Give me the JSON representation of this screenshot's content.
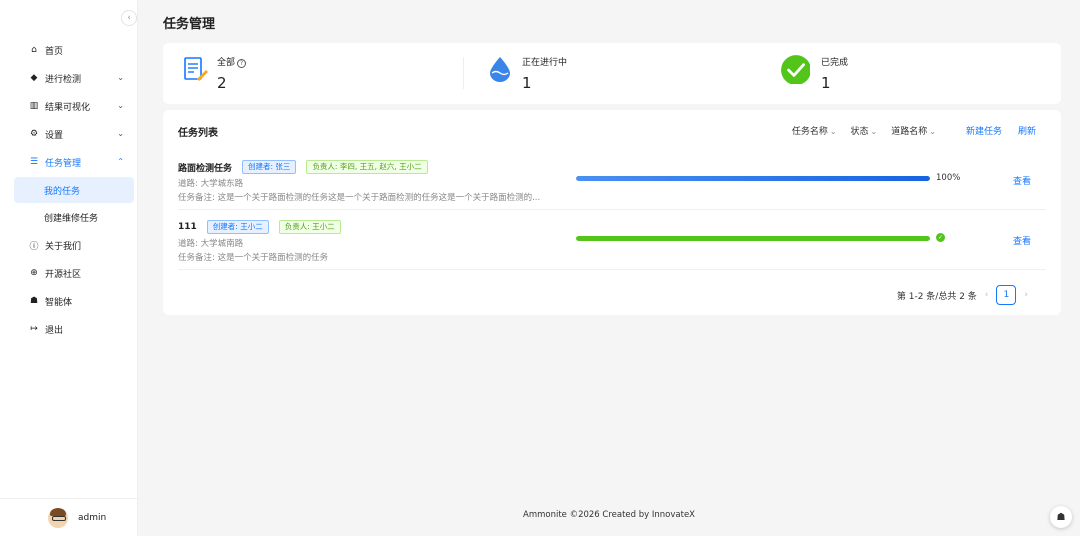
{
  "sidebar": {
    "items": [
      {
        "label": "首页",
        "icon": "home-icon"
      },
      {
        "label": "进行检测",
        "icon": "box-icon"
      },
      {
        "label": "结果可视化",
        "icon": "chart-icon"
      },
      {
        "label": "设置",
        "icon": "gears-icon"
      },
      {
        "label": "任务管理",
        "icon": "list-icon"
      },
      {
        "label": "关于我们",
        "icon": "info-icon"
      },
      {
        "label": "开源社区",
        "icon": "globe-icon"
      },
      {
        "label": "智能体",
        "icon": "robot-icon"
      },
      {
        "label": "退出",
        "icon": "logout-icon"
      }
    ],
    "sub_items": [
      {
        "label": "我的任务"
      },
      {
        "label": "创建维修任务"
      }
    ],
    "user": {
      "name": "admin"
    }
  },
  "page": {
    "title": "任务管理"
  },
  "stats": {
    "all": {
      "label": "全部",
      "value": "2"
    },
    "in_progress": {
      "label": "正在进行中",
      "value": "1"
    },
    "done": {
      "label": "已完成",
      "value": "1"
    }
  },
  "panel": {
    "title": "任务列表",
    "filters": [
      "任务名称",
      "状态",
      "道路名称"
    ],
    "new_task": "新建任务",
    "refresh": "刷新"
  },
  "tasks": [
    {
      "name": "路面检测任务",
      "creator": "创建者: 张三",
      "owners": "负责人: 李四, 王五, 赵六, 王小二",
      "road": "道路: 大学城东路",
      "note": "任务备注: 这是一个关于路面检测的任务这是一个关于路面检测的任务这是一个关于路面检测的...",
      "progress": 100,
      "progress_text": "100%",
      "view": "查看"
    },
    {
      "name": "111",
      "creator": "创建者: 王小二",
      "owners": "负责人: 王小二",
      "road": "道路: 大学城南路",
      "note": "任务备注: 这是一个关于路面检测的任务",
      "progress": 100,
      "view": "查看"
    }
  ],
  "pagination": {
    "summary": "第 1-2 条/总共 2 条",
    "current": "1"
  },
  "footer": {
    "text": "Ammonite ©2026 Created by InnovateX"
  },
  "colors": {
    "primary": "#1677ff",
    "success": "#52c41a"
  }
}
